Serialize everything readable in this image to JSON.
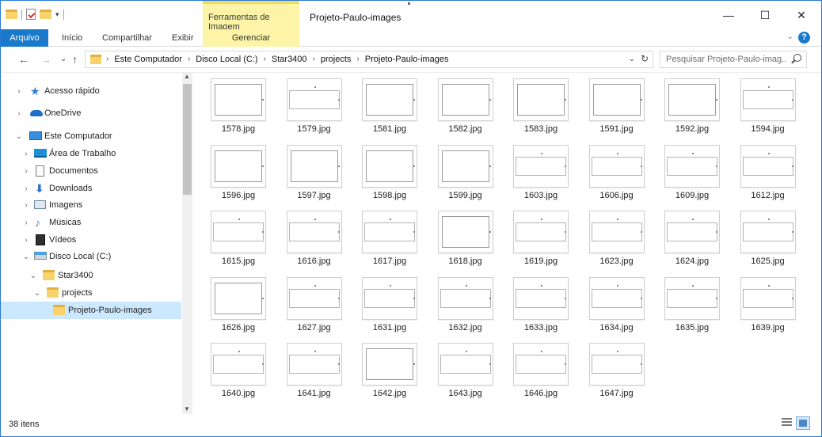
{
  "window": {
    "title": "Projeto-Paulo-images",
    "contextual_tab_header": "Ferramentas de Imagem",
    "controls": {
      "minimize": "—",
      "maximize": "☐",
      "close": "✕"
    }
  },
  "ribbon": {
    "tabs": [
      {
        "label": "Arquivo"
      },
      {
        "label": "Início"
      },
      {
        "label": "Compartilhar"
      },
      {
        "label": "Exibir"
      }
    ],
    "contextual_tab": "Gerenciar",
    "collapse_glyph": "⌄",
    "help_glyph": "?"
  },
  "address": {
    "breadcrumbs": [
      "Este Computador",
      "Disco Local (C:)",
      "Star3400",
      "projects",
      "Projeto-Paulo-images"
    ],
    "separator": "›",
    "search_placeholder": "Pesquisar Projeto-Paulo-imag..."
  },
  "nav": {
    "back": "←",
    "forward": "→",
    "recent": "⌄",
    "up": "↑",
    "items": [
      {
        "label": "Acesso rápido",
        "icon": "star-icon",
        "chevron": "›"
      },
      {
        "label": "OneDrive",
        "icon": "cloud-icon",
        "chevron": "›"
      },
      {
        "label": "Este Computador",
        "icon": "computer-icon",
        "chevron": "⌄"
      },
      {
        "label": "Área de Trabalho",
        "icon": "desktop-icon",
        "chevron": "›"
      },
      {
        "label": "Documentos",
        "icon": "document-icon",
        "chevron": "›"
      },
      {
        "label": "Downloads",
        "icon": "download-icon",
        "chevron": "›"
      },
      {
        "label": "Imagens",
        "icon": "pictures-icon",
        "chevron": "›"
      },
      {
        "label": "Músicas",
        "icon": "music-icon",
        "chevron": "›"
      },
      {
        "label": "Vídeos",
        "icon": "video-icon",
        "chevron": "›"
      },
      {
        "label": "Disco Local (C:)",
        "icon": "drive-icon",
        "chevron": "⌄"
      },
      {
        "label": "Star3400",
        "icon": "folder-icon",
        "chevron": "⌄"
      },
      {
        "label": "projects",
        "icon": "folder-icon",
        "chevron": "⌄"
      },
      {
        "label": "Projeto-Paulo-images",
        "icon": "folder-icon",
        "chevron": ""
      }
    ]
  },
  "files": [
    "1578.jpg",
    "1579.jpg",
    "1581.jpg",
    "1582.jpg",
    "1583.jpg",
    "1591.jpg",
    "1592.jpg",
    "1594.jpg",
    "1596.jpg",
    "1597.jpg",
    "1598.jpg",
    "1599.jpg",
    "1603.jpg",
    "1606.jpg",
    "1609.jpg",
    "1612.jpg",
    "1615.jpg",
    "1616.jpg",
    "1617.jpg",
    "1618.jpg",
    "1619.jpg",
    "1623.jpg",
    "1624.jpg",
    "1625.jpg",
    "1626.jpg",
    "1627.jpg",
    "1631.jpg",
    "1632.jpg",
    "1633.jpg",
    "1634.jpg",
    "1635.jpg",
    "1639.jpg",
    "1640.jpg",
    "1641.jpg",
    "1642.jpg",
    "1643.jpg",
    "1646.jpg",
    "1647.jpg"
  ],
  "status": {
    "item_count": "38 itens"
  }
}
